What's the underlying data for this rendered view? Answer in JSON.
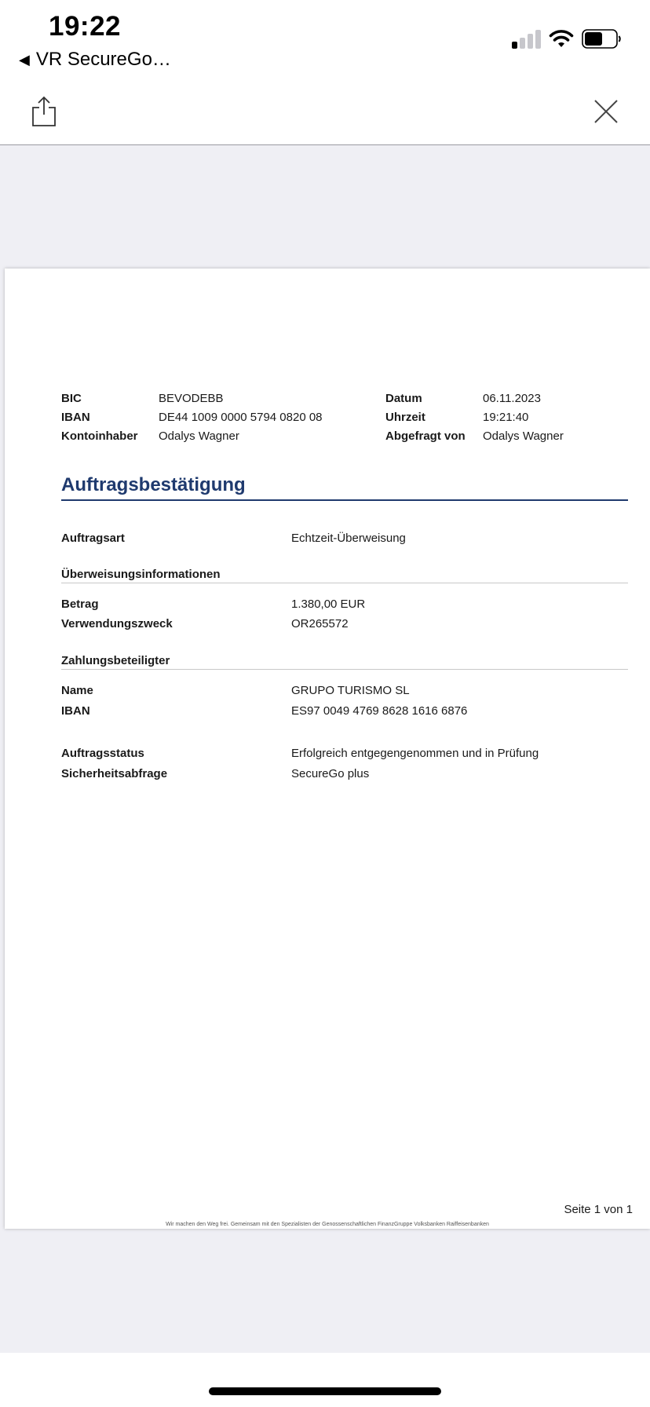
{
  "status_bar": {
    "time": "19:22",
    "back_app": "VR SecureGo…",
    "icons": [
      "back-arrow-icon",
      "signal-icon",
      "wifi-icon",
      "battery-icon"
    ]
  },
  "toolbar": {
    "icons": [
      "share-icon",
      "close-icon"
    ]
  },
  "document": {
    "header_left": [
      {
        "label": "BIC",
        "value": "BEVODEBB"
      },
      {
        "label": "IBAN",
        "value": "DE44 1009 0000 5794 0820 08"
      },
      {
        "label": "Kontoinhaber",
        "value": "Odalys Wagner"
      }
    ],
    "header_right": [
      {
        "label": "Datum",
        "value": "06.11.2023"
      },
      {
        "label": "Uhrzeit",
        "value": "19:21:40"
      },
      {
        "label": "Abgefragt von",
        "value": "Odalys Wagner"
      }
    ],
    "title": "Auftragsbestätigung",
    "order_type": {
      "label": "Auftragsart",
      "value": "Echtzeit-Überweisung"
    },
    "transfer_section": {
      "heading": "Überweisungsinformationen",
      "rows": [
        {
          "label": "Betrag",
          "value": "1.380,00 EUR"
        },
        {
          "label": "Verwendungszweck",
          "value": "OR265572"
        }
      ]
    },
    "payee_section": {
      "heading": "Zahlungsbeteiligter",
      "rows": [
        {
          "label": "Name",
          "value": "GRUPO TURISMO SL"
        },
        {
          "label": "IBAN",
          "value": "ES97 0049 4769 8628 1616 6876"
        }
      ]
    },
    "status_rows": [
      {
        "label": "Auftragsstatus",
        "value": "Erfolgreich entgegengenommen und in Prüfung"
      },
      {
        "label": "Sicherheitsabfrage",
        "value": "SecureGo plus"
      }
    ],
    "page_number": "Seite 1 von 1",
    "footer": "Wir machen den Weg frei. Gemeinsam mit den Spezialisten der Genossenschaftlichen FinanzGruppe Volksbanken Raiffeisenbanken"
  },
  "colors": {
    "title": "#1f3a6e",
    "viewer_background": "#efeff4"
  }
}
